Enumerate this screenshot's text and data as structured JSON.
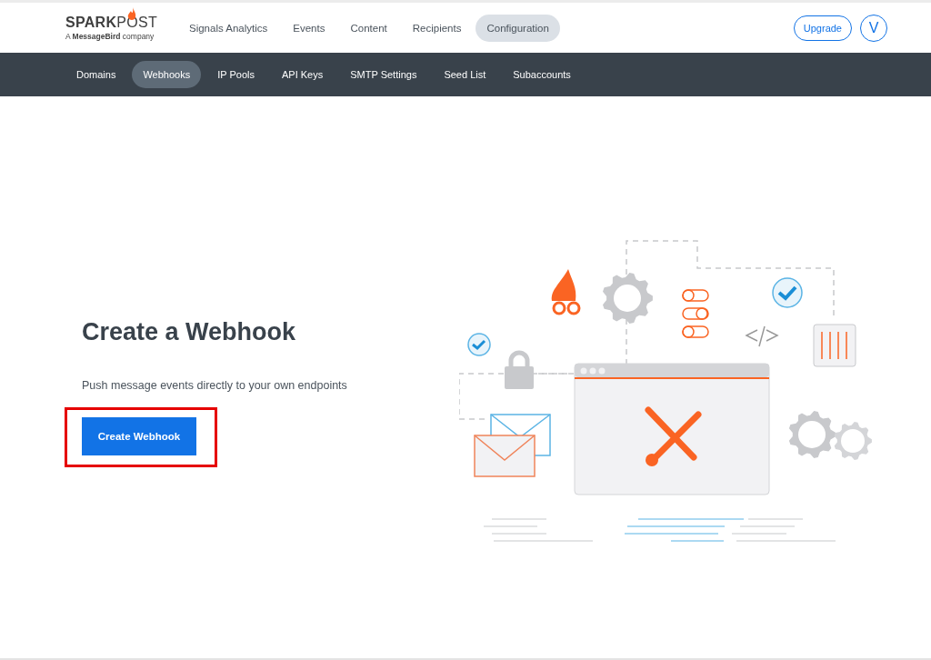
{
  "logo": {
    "wordmark_left": "SPARK",
    "wordmark_right": "POST",
    "tagline": "A **MessageBird** company"
  },
  "top_nav": [
    {
      "label": "Signals Analytics",
      "selected": false
    },
    {
      "label": "Events",
      "selected": false
    },
    {
      "label": "Content",
      "selected": false
    },
    {
      "label": "Recipients",
      "selected": false
    },
    {
      "label": "Configuration",
      "selected": true
    }
  ],
  "upgrade_button": "Upgrade",
  "avatar": "V",
  "sub_nav": [
    {
      "label": "Domains",
      "selected": false
    },
    {
      "label": "Webhooks",
      "selected": true
    },
    {
      "label": "IP Pools",
      "selected": false
    },
    {
      "label": "API Keys",
      "selected": false
    },
    {
      "label": "SMTP Settings",
      "selected": false
    },
    {
      "label": "Seed List",
      "selected": false
    },
    {
      "label": "Subaccounts",
      "selected": false
    }
  ],
  "empty_state": {
    "title": "Create a Webhook",
    "description": "Push message events directly to your own endpoints",
    "button": {
      "label": "Create Webhook",
      "highlighted": true
    }
  }
}
